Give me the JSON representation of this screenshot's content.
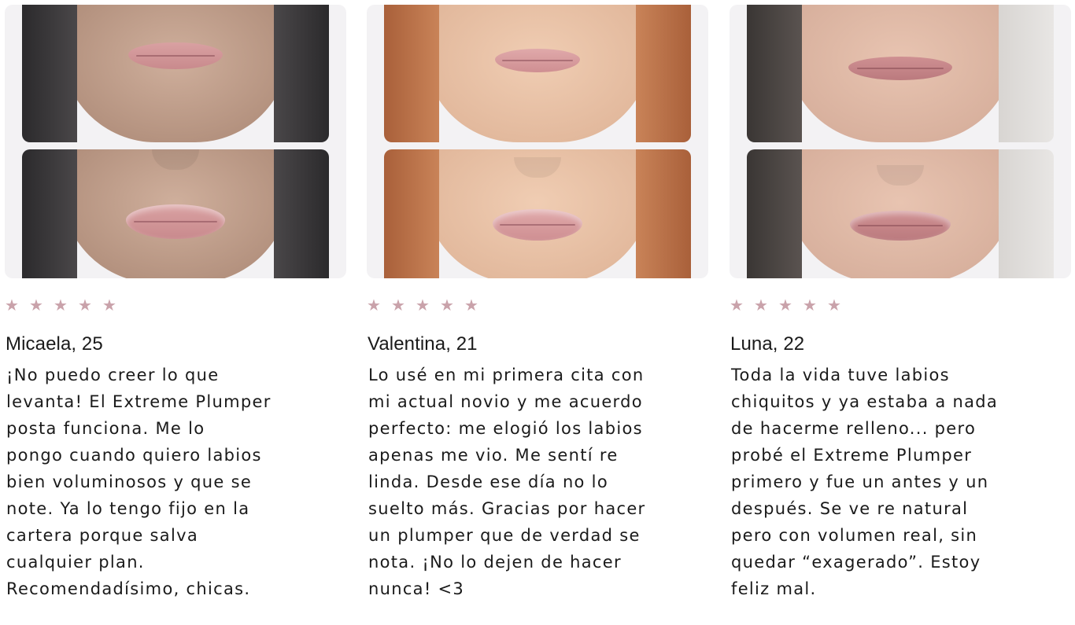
{
  "colors": {
    "star": "#c9a2aa",
    "text": "#1a1a1a",
    "photo_frame": "#f3f2f4"
  },
  "star_icon": "★",
  "reviews": [
    {
      "name": "Micaela, 25",
      "rating": 5,
      "text": "¡No puedo creer lo que\nlevanta! El Extreme Plumper\nposta funciona. Me lo\npongo cuando quiero labios\nbien voluminosos y que se\nnote. Ya lo tengo fijo en la\ncartera porque salva\ncualquier plan.\nRecomendadísimo, chicas."
    },
    {
      "name": "Valentina, 21",
      "rating": 5,
      "text": "Lo usé en mi primera cita con\nmi actual novio y me acuerdo\nperfecto: me elogió los labios\napenas me vio. Me sentí re\nlinda. Desde ese día no lo\nsuelto más. Gracias por hacer\nun plumper que de verdad se\nnota. ¡No lo dejen de hacer\nnunca! <3"
    },
    {
      "name": "Luna, 22",
      "rating": 5,
      "text": "Toda la vida tuve labios\nchiquitos y ya estaba a nada\nde hacerme relleno... pero\nprobé el Extreme Plumper\nprimero y fue un antes y un\ndespués. Se ve re natural\npero con volumen real, sin\nquedar “exagerado”. Estoy\nfeliz mal."
    }
  ]
}
